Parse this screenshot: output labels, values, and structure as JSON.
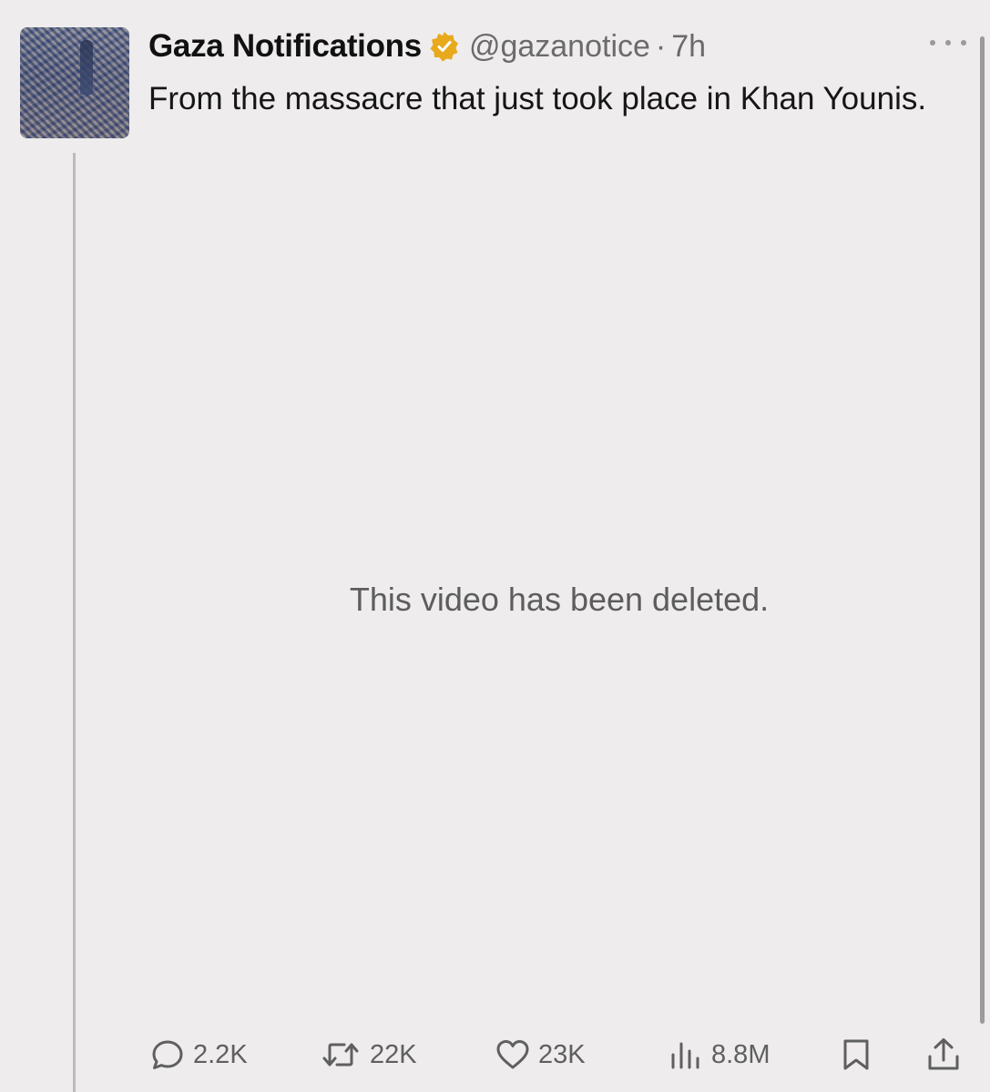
{
  "tweet": {
    "display_name": "Gaza Notifications",
    "handle": "@gazanotice",
    "separator": "·",
    "time": "7h",
    "text": "From the massacre that just took place in Khan Younis.",
    "media_message": "This video has been deleted.",
    "verified_icon": "verified-badge-icon",
    "verified_color": "#e8a91c"
  },
  "actions": {
    "replies": "2.2K",
    "reposts": "22K",
    "likes": "23K",
    "views": "8.8M"
  }
}
